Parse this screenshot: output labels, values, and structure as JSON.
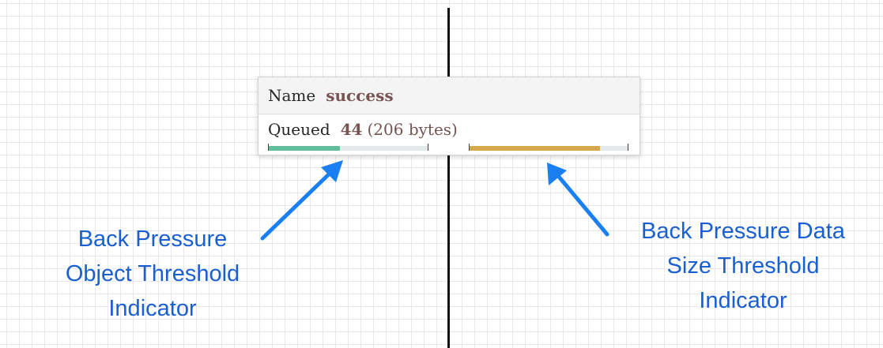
{
  "connection": {
    "name_label": "Name",
    "name_value": "success",
    "queued_label": "Queued",
    "queued_count": "44",
    "queued_size": "(206 bytes)",
    "object_threshold_fill_fraction": 0.45,
    "data_size_threshold_fill_fraction": 0.82,
    "object_bar_color": "#5fbf9a",
    "data_size_bar_color": "#d6a84c"
  },
  "annotations": {
    "object_threshold": [
      "Back Pressure",
      "Object Threshold",
      "Indicator"
    ],
    "data_size_threshold": [
      "Back Pressure Data",
      "Size Threshold",
      "Indicator"
    ],
    "arrow_color": "#1a7ff0"
  }
}
